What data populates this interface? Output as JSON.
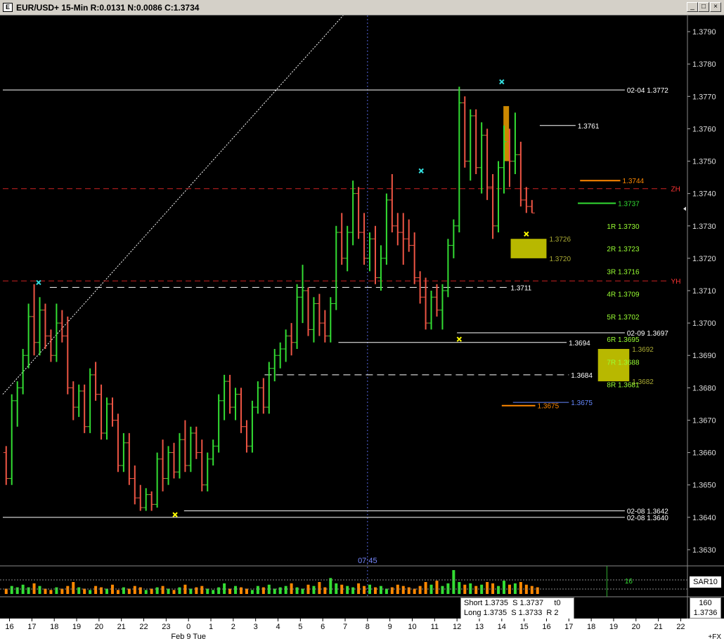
{
  "window": {
    "title": "EUR/USD+ 15-Min R:0.0131 N:0.0086 C:1.3734",
    "buttons": {
      "minimize": "_",
      "maximize": "□",
      "close": "×"
    }
  },
  "colors": {
    "background": "#000000",
    "up_bar": "#33dd33",
    "down_bar": "#ee5544",
    "grid_white": "#ffffff",
    "zone_yellow": "#cccc00",
    "level_green": "#99ff33",
    "red_dash": "#cc2222",
    "orange": "#ff8800",
    "blue": "#6688ff",
    "cyan": "#33dddd",
    "yellow": "#ffff00"
  },
  "chart_data": {
    "type": "ohlc",
    "title": "EUR/USD+ 15-Min R:0.0131 N:0.0086 C:1.3734",
    "ylim": [
      1.3625,
      1.3795
    ],
    "y_ticks": [
      1.363,
      1.364,
      1.365,
      1.366,
      1.367,
      1.368,
      1.369,
      1.37,
      1.371,
      1.372,
      1.373,
      1.374,
      1.375,
      1.376,
      1.377,
      1.378,
      1.379
    ],
    "x_ticks": [
      "16",
      "17",
      "18",
      "19",
      "20",
      "21",
      "22",
      "23",
      "0",
      "1",
      "2",
      "3",
      "4",
      "5",
      "6",
      "7",
      "8",
      "9",
      "10",
      "11",
      "12",
      "13",
      "14",
      "15",
      "16",
      "17",
      "18",
      "19",
      "20",
      "21",
      "22"
    ],
    "x_ticks_pos": [
      -0.5,
      0.5,
      1.5,
      2.5,
      3.5,
      4.5,
      5.5,
      6.5,
      7.5,
      8.5,
      9.5,
      10.5,
      11.5,
      12.5,
      13.5,
      14.5,
      15.5,
      16.5,
      17.5,
      18.5,
      19.5,
      20.5,
      21.5,
      22.5,
      23.5,
      24.5,
      25.5,
      26.5,
      27.5,
      28.5,
      29.5
    ],
    "x_range": [
      -0.8,
      29.8
    ],
    "date_label": "Feb 9 Tue",
    "date_label_pos": 7.5,
    "session_marker_label": "07:45",
    "session_marker_pos": 15.5,
    "bars_per_hour": 4,
    "bars": [
      [
        1.366,
        1.3662,
        1.365,
        1.3652
      ],
      [
        1.3652,
        1.3678,
        1.365,
        1.3676
      ],
      [
        1.3676,
        1.3682,
        1.3668,
        1.368
      ],
      [
        1.368,
        1.3692,
        1.3678,
        1.369
      ],
      [
        1.369,
        1.3706,
        1.3686,
        1.3702
      ],
      [
        1.3702,
        1.3712,
        1.369,
        1.3694
      ],
      [
        1.3694,
        1.3708,
        1.369,
        1.3704
      ],
      [
        1.3704,
        1.3706,
        1.3692,
        1.3696
      ],
      [
        1.3696,
        1.3698,
        1.3688,
        1.369
      ],
      [
        1.369,
        1.3706,
        1.3688,
        1.37
      ],
      [
        1.37,
        1.3704,
        1.3694,
        1.3696
      ],
      [
        1.3696,
        1.3702,
        1.3678,
        1.368
      ],
      [
        1.368,
        1.3682,
        1.367,
        1.3674
      ],
      [
        1.3674,
        1.3681,
        1.3671,
        1.3679
      ],
      [
        1.3679,
        1.3681,
        1.3666,
        1.3668
      ],
      [
        1.3668,
        1.3686,
        1.3666,
        1.3684
      ],
      [
        1.3684,
        1.3688,
        1.3676,
        1.3678
      ],
      [
        1.3678,
        1.3681,
        1.3664,
        1.3666
      ],
      [
        1.3666,
        1.3677,
        1.3664,
        1.3675
      ],
      [
        1.3675,
        1.3677,
        1.3668,
        1.367
      ],
      [
        1.367,
        1.3672,
        1.3654,
        1.3656
      ],
      [
        1.3656,
        1.3666,
        1.3654,
        1.3663
      ],
      [
        1.3663,
        1.3666,
        1.365,
        1.3652
      ],
      [
        1.3652,
        1.3656,
        1.3644,
        1.3646
      ],
      [
        1.3646,
        1.365,
        1.3642,
        1.3643
      ],
      [
        1.3643,
        1.3649,
        1.3642,
        1.3647
      ],
      [
        1.3647,
        1.3648,
        1.3642,
        1.3644
      ],
      [
        1.3644,
        1.366,
        1.3643,
        1.3658
      ],
      [
        1.3658,
        1.3664,
        1.3648,
        1.3652
      ],
      [
        1.3652,
        1.3662,
        1.365,
        1.366
      ],
      [
        1.366,
        1.3663,
        1.3652,
        1.3654
      ],
      [
        1.3654,
        1.3666,
        1.3652,
        1.3664
      ],
      [
        1.3664,
        1.367,
        1.3654,
        1.3656
      ],
      [
        1.3656,
        1.3668,
        1.3654,
        1.3666
      ],
      [
        1.3666,
        1.3668,
        1.3658,
        1.366
      ],
      [
        1.366,
        1.3664,
        1.3648,
        1.365
      ],
      [
        1.365,
        1.366,
        1.3648,
        1.3658
      ],
      [
        1.3658,
        1.3664,
        1.3656,
        1.3662
      ],
      [
        1.3662,
        1.3678,
        1.366,
        1.3676
      ],
      [
        1.3676,
        1.3684,
        1.367,
        1.3682
      ],
      [
        1.3682,
        1.3684,
        1.3672,
        1.3674
      ],
      [
        1.3674,
        1.368,
        1.367,
        1.3678
      ],
      [
        1.3678,
        1.368,
        1.3666,
        1.3668
      ],
      [
        1.3668,
        1.367,
        1.366,
        1.3662
      ],
      [
        1.3662,
        1.3676,
        1.366,
        1.3674
      ],
      [
        1.3674,
        1.3682,
        1.3672,
        1.368
      ],
      [
        1.368,
        1.3683,
        1.3672,
        1.3674
      ],
      [
        1.3674,
        1.3688,
        1.3672,
        1.3686
      ],
      [
        1.3686,
        1.3692,
        1.3682,
        1.369
      ],
      [
        1.369,
        1.3694,
        1.3686,
        1.3692
      ],
      [
        1.3692,
        1.3698,
        1.3688,
        1.3696
      ],
      [
        1.3696,
        1.37,
        1.369,
        1.3694
      ],
      [
        1.3694,
        1.3712,
        1.3692,
        1.3708
      ],
      [
        1.3708,
        1.3718,
        1.37,
        1.371
      ],
      [
        1.371,
        1.3711,
        1.3696,
        1.3698
      ],
      [
        1.3698,
        1.3708,
        1.3694,
        1.3706
      ],
      [
        1.3706,
        1.3709,
        1.3696,
        1.37
      ],
      [
        1.37,
        1.3704,
        1.3694,
        1.3696
      ],
      [
        1.3696,
        1.3708,
        1.3694,
        1.3706
      ],
      [
        1.3706,
        1.373,
        1.3704,
        1.3728
      ],
      [
        1.3728,
        1.3734,
        1.3718,
        1.372
      ],
      [
        1.372,
        1.373,
        1.3716,
        1.3728
      ],
      [
        1.3728,
        1.3744,
        1.3724,
        1.374
      ],
      [
        1.374,
        1.3742,
        1.3726,
        1.3728
      ],
      [
        1.3728,
        1.3734,
        1.3718,
        1.372
      ],
      [
        1.372,
        1.3728,
        1.3716,
        1.3726
      ],
      [
        1.3726,
        1.373,
        1.3712,
        1.3714
      ],
      [
        1.3714,
        1.3724,
        1.371,
        1.372
      ],
      [
        1.372,
        1.374,
        1.3718,
        1.3738
      ],
      [
        1.3738,
        1.3746,
        1.3728,
        1.373
      ],
      [
        1.373,
        1.3734,
        1.3724,
        1.3728
      ],
      [
        1.3728,
        1.3734,
        1.3718,
        1.3726
      ],
      [
        1.3726,
        1.3732,
        1.3722,
        1.3724
      ],
      [
        1.3724,
        1.3728,
        1.3712,
        1.3714
      ],
      [
        1.3714,
        1.3716,
        1.3706,
        1.3708
      ],
      [
        1.3708,
        1.3714,
        1.3698,
        1.37
      ],
      [
        1.37,
        1.371,
        1.3698,
        1.3708
      ],
      [
        1.3708,
        1.3712,
        1.3702,
        1.3704
      ],
      [
        1.3704,
        1.3712,
        1.3698,
        1.371
      ],
      [
        1.371,
        1.3726,
        1.3708,
        1.3724
      ],
      [
        1.3724,
        1.3732,
        1.372,
        1.373
      ],
      [
        1.373,
        1.3773,
        1.3728,
        1.3768
      ],
      [
        1.3768,
        1.377,
        1.3748,
        1.375
      ],
      [
        1.375,
        1.3766,
        1.3744,
        1.3764
      ],
      [
        1.3764,
        1.3766,
        1.3746,
        1.3748
      ],
      [
        1.3748,
        1.3762,
        1.374,
        1.3758
      ],
      [
        1.3758,
        1.376,
        1.3738,
        1.3742
      ],
      [
        1.3742,
        1.3746,
        1.3726,
        1.373
      ],
      [
        1.373,
        1.375,
        1.3728,
        1.3748
      ],
      [
        1.3748,
        1.3761,
        1.374,
        1.3756
      ],
      [
        1.3756,
        1.376,
        1.3742,
        1.375
      ],
      [
        1.375,
        1.3765,
        1.3746,
        1.3752
      ],
      [
        1.3752,
        1.3756,
        1.3736,
        1.3738
      ],
      [
        1.3738,
        1.3742,
        1.3734,
        1.3736
      ],
      [
        1.3736,
        1.3738,
        1.3734,
        1.3734
      ]
    ],
    "volume": [
      4,
      6,
      5,
      7,
      5,
      8,
      6,
      4,
      3,
      5,
      4,
      6,
      9,
      5,
      4,
      3,
      6,
      5,
      4,
      7,
      3,
      5,
      4,
      6,
      5,
      3,
      4,
      5,
      6,
      4,
      3,
      5,
      7,
      4,
      5,
      6,
      4,
      3,
      5,
      8,
      4,
      6,
      5,
      4,
      3,
      6,
      5,
      7,
      4,
      5,
      6,
      8,
      5,
      4,
      7,
      6,
      9,
      5,
      12,
      8,
      7,
      6,
      5,
      8,
      6,
      7,
      5,
      6,
      4,
      5,
      7,
      6,
      5,
      4,
      6,
      9,
      7,
      10,
      6,
      8,
      18,
      9,
      7,
      8,
      6,
      7,
      9,
      8,
      6,
      10,
      7,
      8,
      9,
      7,
      6,
      5
    ],
    "price_axis_labels": [
      "1.3630",
      "1.3640",
      "1.3650",
      "1.3660",
      "1.3670",
      "1.3680",
      "1.3690",
      "1.3700",
      "1.3710",
      "1.3720",
      "1.3730",
      "1.3740",
      "1.3750",
      "1.3760",
      "1.3770",
      "1.3780",
      "1.3790"
    ],
    "horizontal_levels": [
      {
        "label": "02-04  1.3772",
        "value": 1.3772,
        "color": "#ffffff",
        "style": "solid",
        "from": -0.8,
        "to": 27.0
      },
      {
        "label": "ZH",
        "value": 1.37415,
        "color": "#cc2222",
        "style": "dash",
        "from": -0.8,
        "to": 29.0
      },
      {
        "label": "YH",
        "value": 1.3713,
        "color": "#cc2222",
        "style": "dash",
        "from": -0.8,
        "to": 29.0
      },
      {
        "label": "1.3711",
        "value": 1.3711,
        "color": "#ffffff",
        "style": "dash",
        "from": 1.3,
        "to": 21.8
      },
      {
        "label": "02-09  1.3697",
        "value": 1.3697,
        "color": "#ffffff",
        "style": "solid",
        "from": 19.5,
        "to": 27.0
      },
      {
        "label": "1.3694",
        "value": 1.3694,
        "color": "#ffffff",
        "style": "solid",
        "from": 14.2,
        "to": 24.4
      },
      {
        "label": "1.3684",
        "value": 1.3684,
        "color": "#ffffff",
        "style": "dash",
        "from": 10.9,
        "to": 24.5
      },
      {
        "label": "02-08  1.3642",
        "value": 1.3642,
        "color": "#ffffff",
        "style": "solid",
        "from": 7.3,
        "to": 27.0
      },
      {
        "label": "02-08  1.3640",
        "value": 1.364,
        "color": "#ffffff",
        "style": "solid",
        "from": -0.8,
        "to": 27.0
      },
      {
        "label": "1.3761",
        "value": 1.3761,
        "color": "#ffffff",
        "style": "solid",
        "from": 23.2,
        "to": 24.8
      },
      {
        "label": "1.3744",
        "value": 1.3744,
        "color": "#ff8800",
        "style": "solid",
        "from": 25.0,
        "to": 26.8
      },
      {
        "label": "1.3737",
        "value": 1.3737,
        "color": "#33dd33",
        "style": "solid",
        "from": 24.9,
        "to": 26.6
      },
      {
        "label": "1.3675",
        "value": 1.36745,
        "color": "#ff8800",
        "style": "solid",
        "from": 21.5,
        "to": 23.0
      },
      {
        "label": "1.3675",
        "value": 1.36755,
        "color": "#6688ff",
        "style": "solid",
        "from": 22.0,
        "to": 24.5
      }
    ],
    "zones": [
      {
        "label_top": "1.3726",
        "label_bottom": "1.3720",
        "top": 1.3726,
        "bottom": 1.372,
        "from": 21.9,
        "to": 23.5
      },
      {
        "label_top": "1.3692",
        "label_bottom": "1.3682",
        "top": 1.3692,
        "bottom": 1.3682,
        "from": 25.8,
        "to": 27.2
      }
    ],
    "r_levels": [
      {
        "label": "1R  1.3730",
        "value": 1.373
      },
      {
        "label": "2R  1.3723",
        "value": 1.3723
      },
      {
        "label": "3R  1.3716",
        "value": 1.3716
      },
      {
        "label": "4R  1.3709",
        "value": 1.3709
      },
      {
        "label": "5R  1.3702",
        "value": 1.3702
      },
      {
        "label": "6R  1.3695",
        "value": 1.3695
      },
      {
        "label": "7R  1.3688",
        "value": 1.3688
      },
      {
        "label": "8R  1.3681",
        "value": 1.3681
      }
    ],
    "markers": [
      {
        "type": "cyan-x",
        "x": 0.8,
        "value": 1.37125
      },
      {
        "type": "yellow-x",
        "x": 6.9,
        "value": 1.36408
      },
      {
        "type": "cyan-x",
        "x": 17.9,
        "value": 1.3747
      },
      {
        "type": "yellow-x",
        "x": 19.6,
        "value": 1.3695
      },
      {
        "type": "cyan-x",
        "x": 21.5,
        "value": 1.37745
      },
      {
        "type": "yellow-x",
        "x": 22.6,
        "value": 1.37275
      }
    ],
    "highlight_bar": {
      "x": 21.7,
      "high": 1.3767,
      "low": 1.375
    },
    "sar_label": "SAR10",
    "volume_level_label": "16"
  },
  "status": {
    "short_line": "Short 1.3735  S 1.3737     t0",
    "long_line": "Long 1.3735  S 1.3733  R 2",
    "counter": "160",
    "current_price": "1.3736"
  },
  "xaxis_extra": "+FX"
}
